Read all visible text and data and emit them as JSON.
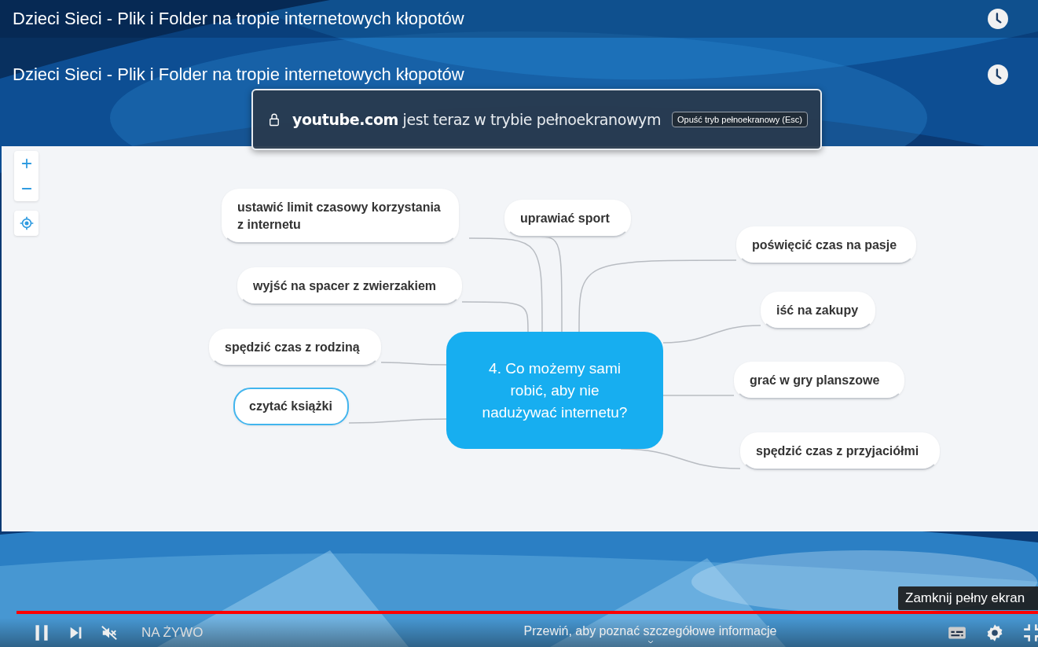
{
  "video_titles": [
    "Dzieci Sieci - Plik i Folder na tropie internetowych kłopotów",
    "Dzieci Sieci - Plik i Folder na tropie internetowych kłopotów"
  ],
  "fullscreen_notice": {
    "site": "youtube.com",
    "message": "jest teraz w trybie pełnoekranowym",
    "button": "Opuść tryb pełnoekranowy (Esc)"
  },
  "mindmap": {
    "central": "4. Co możemy sami robić, aby nie nadużywać internetu?",
    "nodes": [
      {
        "label": "ustawić limit czasowy korzystania z internetu",
        "selected": false
      },
      {
        "label": "uprawiać sport",
        "selected": false
      },
      {
        "label": "poświęcić czas na pasje",
        "selected": false
      },
      {
        "label": "wyjść na spacer z zwierzakiem",
        "selected": false
      },
      {
        "label": "iść na zakupy",
        "selected": false
      },
      {
        "label": "spędzić czas z rodziną",
        "selected": false
      },
      {
        "label": "grać w gry planszowe",
        "selected": false
      },
      {
        "label": "czytać książki",
        "selected": true
      },
      {
        "label": "spędzić czas z przyjaciółmi",
        "selected": false
      }
    ]
  },
  "player": {
    "progress": {
      "level": 1
    },
    "live_label": "NA ŻYWO",
    "hint": "Przewiń, aby poznać szczegółowe informacje",
    "tooltip": "Zamknij pełny ekran"
  }
}
